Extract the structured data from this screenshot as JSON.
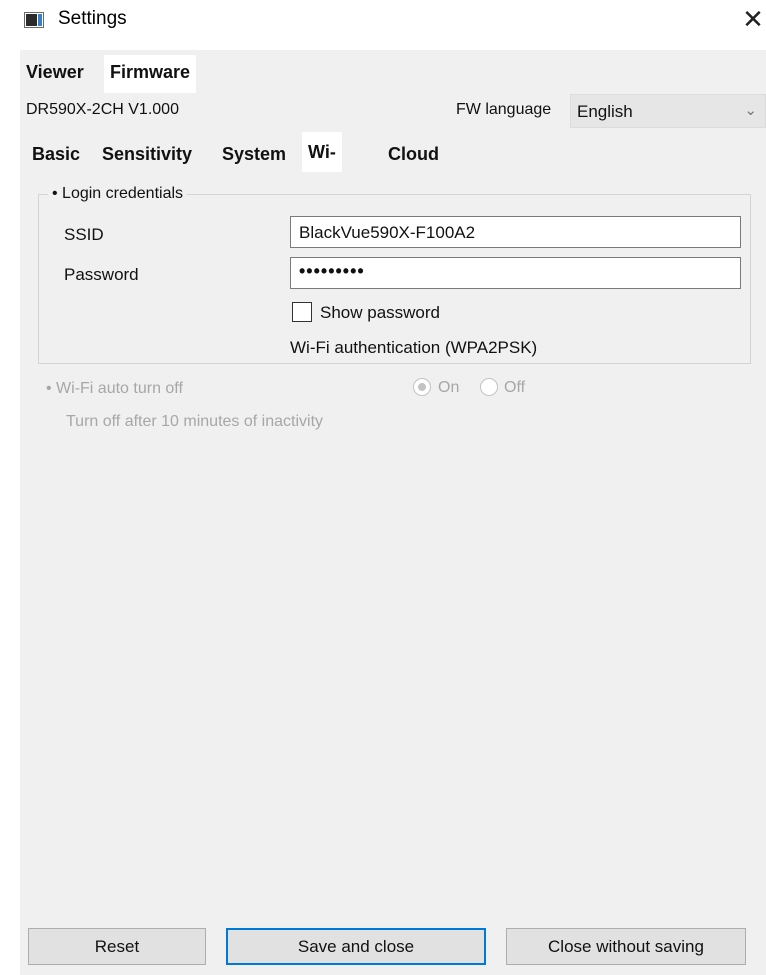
{
  "window": {
    "title": "Settings",
    "close_symbol": "✕"
  },
  "outer_tabs": [
    {
      "label": "Viewer",
      "active": false
    },
    {
      "label": "Firmware",
      "active": true
    }
  ],
  "firmware": {
    "model_version": "DR590X-2CH  V1.000",
    "fw_language_label": "FW language",
    "fw_language_value": "English"
  },
  "inner_tabs": [
    {
      "label": "Basic",
      "active": false
    },
    {
      "label": "Sensitivity",
      "active": false
    },
    {
      "label": "System",
      "active": false
    },
    {
      "label": "Wi-Fi",
      "active": true
    },
    {
      "label": "Cloud",
      "active": false
    }
  ],
  "login": {
    "title": "• Login credentials",
    "ssid_label": "SSID",
    "ssid_value": "BlackVue590X-F100A2",
    "password_label": "Password",
    "password_masked": "•••••••••",
    "show_password_label": "Show password",
    "show_password_checked": false,
    "auth_text": "Wi-Fi authentication (WPA2PSK)"
  },
  "auto_off": {
    "title": "• Wi-Fi auto turn off",
    "on_label": "On",
    "off_label": "Off",
    "selected": "On",
    "description": "Turn off after 10 minutes of inactivity",
    "enabled": false
  },
  "buttons": {
    "reset": "Reset",
    "save_close": "Save and close",
    "close_no_save": "Close without saving"
  },
  "colors": {
    "focus_border": "#0078d7",
    "panel_bg": "#f0f0f0"
  }
}
